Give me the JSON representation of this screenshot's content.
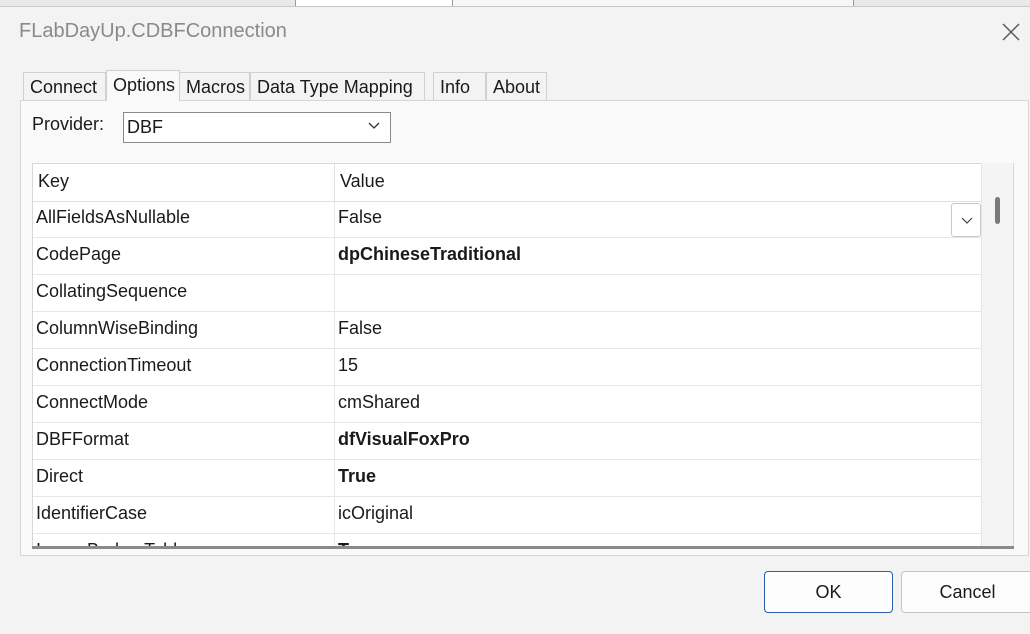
{
  "window": {
    "title": "FLabDayUp.CDBFConnection"
  },
  "tabs": [
    {
      "label": "Connect"
    },
    {
      "label": "Options",
      "active": true
    },
    {
      "label": "Macros"
    },
    {
      "label": "Data Type Mapping"
    },
    {
      "label": "Info"
    },
    {
      "label": "About"
    }
  ],
  "provider": {
    "label": "Provider:",
    "value": "DBF"
  },
  "grid": {
    "headers": {
      "key": "Key",
      "value": "Value"
    },
    "rows": [
      {
        "key": "AllFieldsAsNullable",
        "value": "False",
        "bold": false,
        "has_dropdown": true
      },
      {
        "key": "CodePage",
        "value": "dpChineseTraditional",
        "bold": true
      },
      {
        "key": "CollatingSequence",
        "value": "",
        "bold": false
      },
      {
        "key": "ColumnWiseBinding",
        "value": "False",
        "bold": false
      },
      {
        "key": "ConnectionTimeout",
        "value": "15",
        "bold": false
      },
      {
        "key": "ConnectMode",
        "value": "cmShared",
        "bold": false
      },
      {
        "key": "DBFFormat",
        "value": "dfVisualFoxPro",
        "bold": true
      },
      {
        "key": "Direct",
        "value": "True",
        "bold": true
      },
      {
        "key": "IdentifierCase",
        "value": "icOriginal",
        "bold": false
      },
      {
        "key": "IgnoreBrokenTables",
        "value": "True",
        "bold": true
      }
    ]
  },
  "buttons": {
    "ok": "OK",
    "cancel": "Cancel"
  },
  "colors": {
    "default_button_border": "#2a5fa8",
    "background": "#f3f3f3"
  }
}
